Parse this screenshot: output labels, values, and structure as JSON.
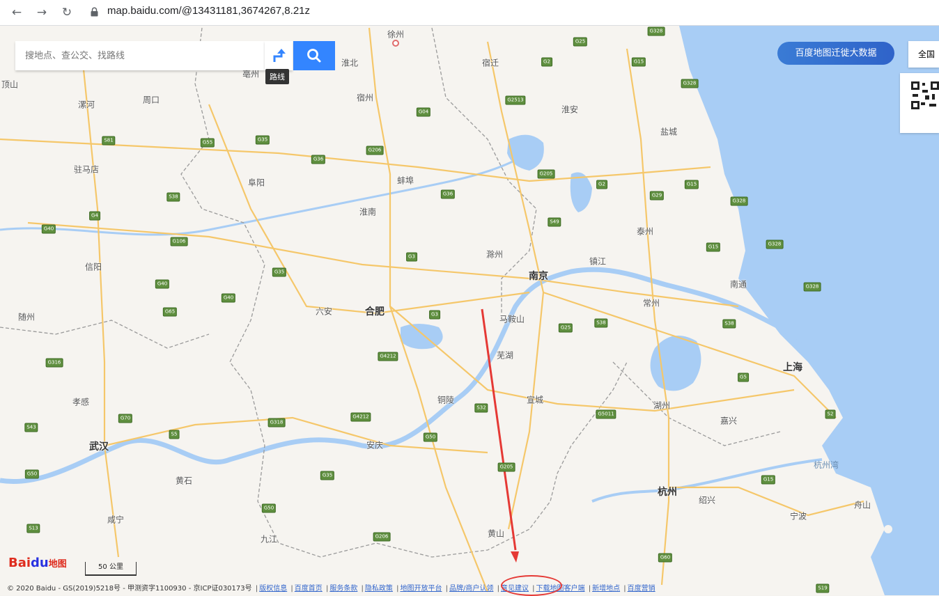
{
  "browser": {
    "url": "map.baidu.com/@13431181,3674267,8.21z"
  },
  "search": {
    "placeholder": "搜地点、查公交、找路线",
    "route_tooltip": "路线"
  },
  "top_right": {
    "bigdata_label": "百度地图迁徙大数据",
    "region_label": "全国"
  },
  "map": {
    "cities": [
      {
        "name": "徐州",
        "big": false
      },
      {
        "name": "宿迁",
        "big": false
      },
      {
        "name": "淮北",
        "big": false
      },
      {
        "name": "亳州",
        "big": false
      },
      {
        "name": "宿州",
        "big": false
      },
      {
        "name": "淮安",
        "big": false
      },
      {
        "name": "盐城",
        "big": false
      },
      {
        "name": "漯河",
        "big": false
      },
      {
        "name": "周口",
        "big": false
      },
      {
        "name": "驻马店",
        "big": false
      },
      {
        "name": "阜阳",
        "big": false
      },
      {
        "name": "蚌埠",
        "big": false
      },
      {
        "name": "淮南",
        "big": false
      },
      {
        "name": "泰州",
        "big": false
      },
      {
        "name": "信阳",
        "big": false
      },
      {
        "name": "滁州",
        "big": false
      },
      {
        "name": "南京",
        "big": true
      },
      {
        "name": "镇江",
        "big": false
      },
      {
        "name": "南通",
        "big": false
      },
      {
        "name": "常州",
        "big": false
      },
      {
        "name": "随州",
        "big": false
      },
      {
        "name": "六安",
        "big": false
      },
      {
        "name": "合肥",
        "big": true
      },
      {
        "name": "马鞍山",
        "big": false
      },
      {
        "name": "芜湖",
        "big": false
      },
      {
        "name": "上海",
        "big": true
      },
      {
        "name": "孝感",
        "big": false
      },
      {
        "name": "铜陵",
        "big": false
      },
      {
        "name": "宣城",
        "big": false
      },
      {
        "name": "湖州",
        "big": false
      },
      {
        "name": "嘉兴",
        "big": false
      },
      {
        "name": "武汉",
        "big": true
      },
      {
        "name": "安庆",
        "big": false
      },
      {
        "name": "黄石",
        "big": false
      },
      {
        "name": "杭州",
        "big": true
      },
      {
        "name": "绍兴",
        "big": false
      },
      {
        "name": "咸宁",
        "big": false
      },
      {
        "name": "九江",
        "big": false
      },
      {
        "name": "黄山",
        "big": false
      },
      {
        "name": "宁波",
        "big": false
      },
      {
        "name": "顶山",
        "big": false
      },
      {
        "name": "舟山",
        "big": false
      }
    ],
    "sea_label": "杭州湾",
    "highways": [
      "G328",
      "G25",
      "G2",
      "G15",
      "G328",
      "G2513",
      "G04",
      "G206",
      "G36",
      "G35",
      "G55",
      "S81",
      "G36",
      "G205",
      "G2",
      "G15",
      "G328",
      "G29",
      "S38",
      "G4",
      "G40",
      "G106",
      "G35",
      "G3",
      "G328",
      "S49",
      "G15",
      "G328",
      "G40",
      "G40",
      "G65",
      "G3",
      "G25",
      "S38",
      "S38",
      "G4212",
      "G5",
      "G316",
      "G70",
      "G318",
      "G4212",
      "G50",
      "S32",
      "G5011",
      "S2",
      "S43",
      "S5",
      "G50",
      "G35",
      "G205",
      "G15",
      "G50",
      "G206",
      "S13",
      "G60",
      "S19"
    ]
  },
  "scale": {
    "label": "50 公里"
  },
  "logo": {
    "bai": "Bai",
    "du": "du",
    "ditu": "地图"
  },
  "footer": {
    "copyright": "© 2020 Baidu - GS(2019)5218号 - 甲测资字1100930 - 京ICP证030173号",
    "links": [
      "版权信息",
      "百度首页",
      "服务条款",
      "隐私政策",
      "地图开放平台",
      "品牌/商户认领",
      "意见建议",
      "下载地图客户端",
      "新增地点",
      "百度营销"
    ]
  }
}
